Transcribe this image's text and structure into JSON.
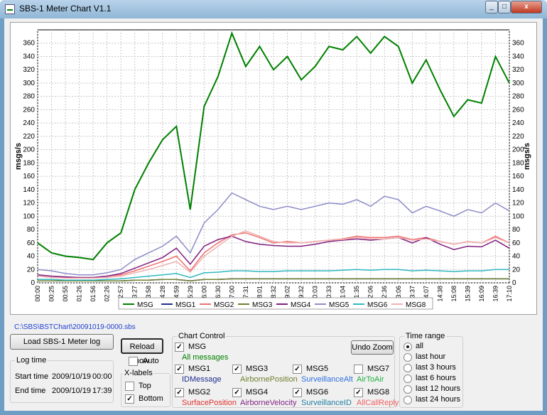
{
  "window": {
    "title": "SBS-1 Meter Chart  V1.1",
    "min": "_",
    "max": "□",
    "close": "x"
  },
  "chart_data": {
    "type": "line",
    "ylabel": "msgs/s",
    "ylabel_right": "msgs/s",
    "ylim": [
      0,
      380
    ],
    "yticks": [
      0,
      20,
      40,
      60,
      80,
      100,
      120,
      140,
      160,
      180,
      200,
      220,
      240,
      260,
      280,
      300,
      320,
      340,
      360
    ],
    "grid": true,
    "legend_position": "bottom",
    "x": [
      "00:00",
      "00:25",
      "00:55",
      "01:26",
      "01:56",
      "02:26",
      "02:57",
      "03:27",
      "03:58",
      "04:28",
      "04:59",
      "05:29",
      "06:00",
      "06:30",
      "07:00",
      "07:31",
      "08:01",
      "08:32",
      "09:02",
      "09:32",
      "10:03",
      "10:33",
      "11:04",
      "11:35",
      "12:06",
      "12:36",
      "13:06",
      "13:37",
      "14:07",
      "14:38",
      "15:08",
      "15:39",
      "16:09",
      "16:39",
      "17:10"
    ],
    "series": [
      {
        "name": "MSG",
        "color": "#008000",
        "values": [
          60,
          45,
          40,
          38,
          35,
          60,
          75,
          140,
          180,
          215,
          235,
          110,
          265,
          310,
          375,
          325,
          355,
          320,
          340,
          305,
          325,
          355,
          350,
          370,
          345,
          370,
          355,
          300,
          335,
          290,
          250,
          275,
          270,
          340,
          300
        ]
      },
      {
        "name": "MSG1",
        "color": "#1f2f8f",
        "values": [
          3,
          3,
          3,
          3,
          3,
          3,
          3,
          4,
          4,
          5,
          5,
          3,
          5,
          5,
          6,
          6,
          6,
          6,
          6,
          6,
          6,
          6,
          6,
          6,
          6,
          6,
          6,
          6,
          6,
          6,
          6,
          6,
          6,
          6,
          6
        ]
      },
      {
        "name": "MSG2",
        "color": "#f07070",
        "values": [
          12,
          10,
          8,
          8,
          8,
          10,
          12,
          18,
          25,
          32,
          40,
          18,
          45,
          60,
          72,
          75,
          68,
          60,
          62,
          60,
          62,
          64,
          66,
          70,
          68,
          68,
          70,
          65,
          68,
          62,
          58,
          62,
          60,
          70,
          60
        ]
      },
      {
        "name": "MSG3",
        "color": "#708030",
        "values": [
          3,
          3,
          3,
          3,
          3,
          3,
          3,
          4,
          4,
          5,
          5,
          3,
          5,
          5,
          6,
          6,
          6,
          6,
          6,
          6,
          6,
          6,
          6,
          6,
          6,
          6,
          6,
          6,
          6,
          6,
          6,
          6,
          6,
          6,
          6
        ]
      },
      {
        "name": "MSG4",
        "color": "#7f1f7f",
        "values": [
          12,
          10,
          9,
          8,
          8,
          10,
          14,
          22,
          30,
          38,
          52,
          28,
          55,
          65,
          70,
          62,
          58,
          56,
          55,
          55,
          58,
          62,
          64,
          66,
          64,
          66,
          68,
          60,
          68,
          58,
          50,
          55,
          54,
          64,
          52
        ]
      },
      {
        "name": "MSG5",
        "color": "#8c8cc8",
        "values": [
          20,
          18,
          14,
          12,
          12,
          15,
          20,
          35,
          45,
          55,
          70,
          45,
          90,
          110,
          135,
          125,
          115,
          110,
          115,
          110,
          115,
          120,
          118,
          125,
          115,
          130,
          125,
          105,
          115,
          108,
          100,
          110,
          105,
          120,
          108
        ]
      },
      {
        "name": "MSG6",
        "color": "#30b8c0",
        "values": [
          5,
          5,
          4,
          4,
          4,
          5,
          6,
          8,
          10,
          12,
          14,
          8,
          15,
          16,
          18,
          18,
          17,
          17,
          18,
          18,
          18,
          18,
          19,
          20,
          19,
          20,
          20,
          18,
          19,
          18,
          17,
          18,
          18,
          20,
          20
        ]
      },
      {
        "name": "MSG8",
        "color": "#f0b0b0",
        "values": [
          10,
          8,
          7,
          7,
          7,
          8,
          10,
          15,
          20,
          26,
          32,
          16,
          40,
          55,
          70,
          78,
          70,
          62,
          60,
          60,
          62,
          64,
          65,
          68,
          66,
          66,
          68,
          64,
          66,
          62,
          58,
          62,
          60,
          68,
          60
        ]
      }
    ]
  },
  "file_path": "C:\\SBS\\BSTChart\\20091019-0000.sbs",
  "load_button": "Load SBS-1 Meter log",
  "reload_button": "Reload now",
  "auto_label": "Auto",
  "log_time": {
    "title": "Log time",
    "start_label": "Start time",
    "start_date": "2009/10/19",
    "start_time": "00:00",
    "end_label": "End time",
    "end_date": "2009/10/19",
    "end_time": "17:39"
  },
  "xlabels": {
    "title": "X-labels",
    "top": "Top",
    "bottom": "Bottom"
  },
  "chart_control": {
    "title": "Chart Control",
    "undo_zoom": "Undo Zoom",
    "msg": {
      "label": "MSG",
      "desc": "All messages"
    },
    "items": [
      {
        "label": "MSG1",
        "desc": "IDMessage",
        "checked": true
      },
      {
        "label": "MSG2",
        "desc": "SurfacePosition",
        "checked": true
      },
      {
        "label": "MSG3",
        "desc": "AirbornePosition",
        "checked": true
      },
      {
        "label": "MSG4",
        "desc": "AirborneVelocity",
        "checked": true
      },
      {
        "label": "MSG5",
        "desc": "SurveillanceAlt",
        "checked": true
      },
      {
        "label": "MSG6",
        "desc": "SurveillanceID",
        "checked": true
      },
      {
        "label": "MSG7",
        "desc": "AirToAir",
        "checked": false
      },
      {
        "label": "MSG8",
        "desc": "AllCallReply",
        "checked": true
      }
    ]
  },
  "time_range": {
    "title": "Time range",
    "options": [
      "all",
      "last hour",
      "last 3 hours",
      "last 6 hours",
      "last 12 hours",
      "last 24 hours"
    ],
    "selected": "all"
  }
}
